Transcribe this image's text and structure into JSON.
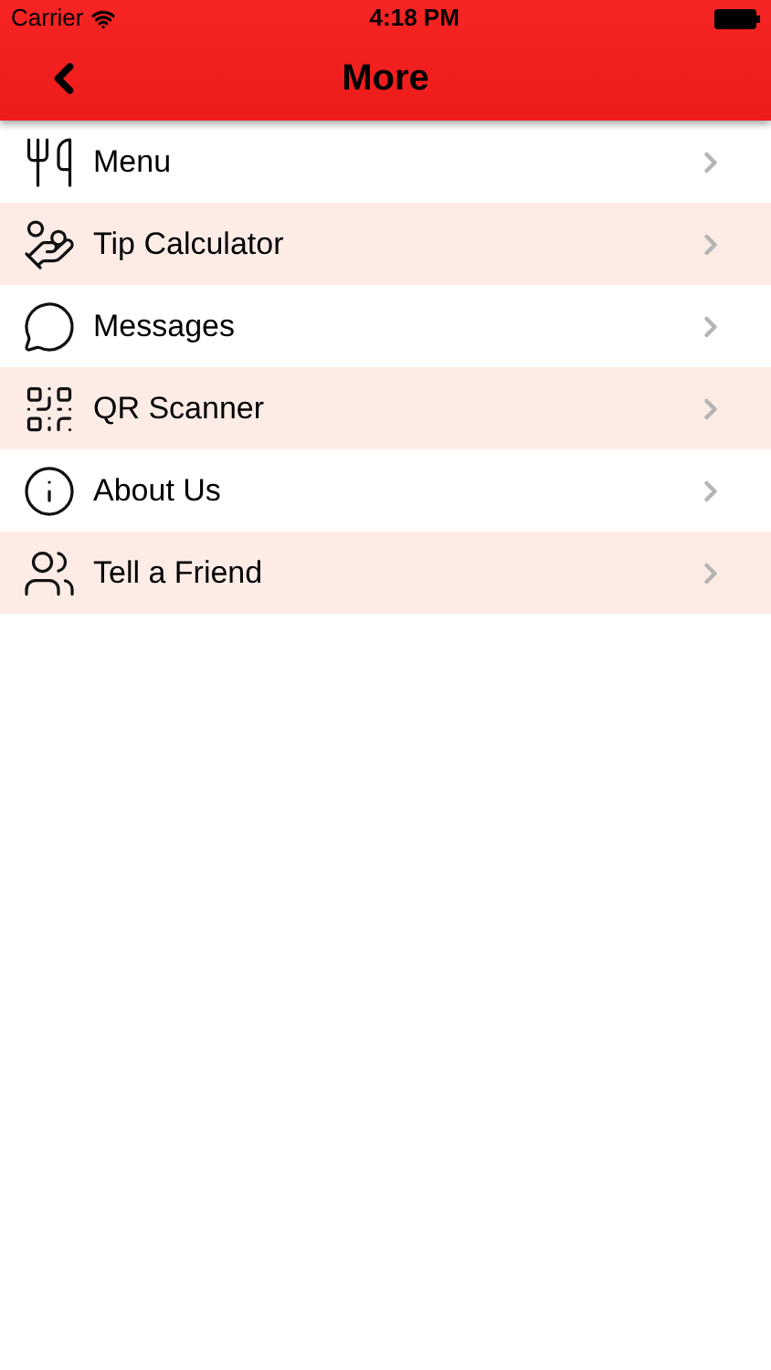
{
  "status_bar": {
    "carrier": "Carrier",
    "time": "4:18 PM"
  },
  "nav": {
    "title": "More"
  },
  "items": [
    {
      "kind": "menu",
      "label": "Menu"
    },
    {
      "kind": "tip",
      "label": "Tip Calculator"
    },
    {
      "kind": "messages",
      "label": "Messages"
    },
    {
      "kind": "qr",
      "label": "QR Scanner"
    },
    {
      "kind": "about",
      "label": "About Us"
    },
    {
      "kind": "friend",
      "label": "Tell a Friend"
    }
  ]
}
